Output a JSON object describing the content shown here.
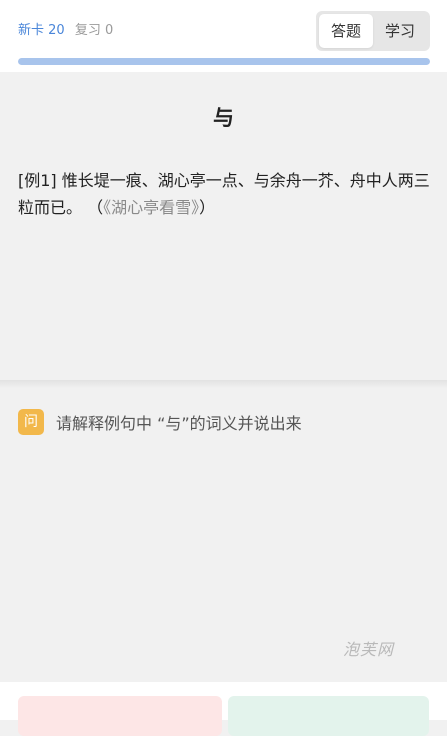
{
  "header": {
    "new_cards_label": "新卡 20",
    "review_label": "复习 0",
    "tabs": [
      {
        "label": "答题"
      },
      {
        "label": "学习"
      }
    ],
    "progress": 1.0
  },
  "card": {
    "character": "与",
    "example_text": "[例1] 惟长堤一痕、湖心亭一点、与余舟一芥、舟中人两三粒而已。",
    "source_open": "（",
    "source_title": "《湖心亭看雪》",
    "source_close": "）"
  },
  "question": {
    "icon_label": "问",
    "text": "请解释例句中 “与”的词义并说出来"
  },
  "watermark": "泡芙网",
  "colors": {
    "accent": "#4a86d9",
    "progress": "#a8c4ec",
    "question_icon": "#f2b84b",
    "unknown_bg": "#fde6e6",
    "known_bg": "#e3f3ec"
  }
}
